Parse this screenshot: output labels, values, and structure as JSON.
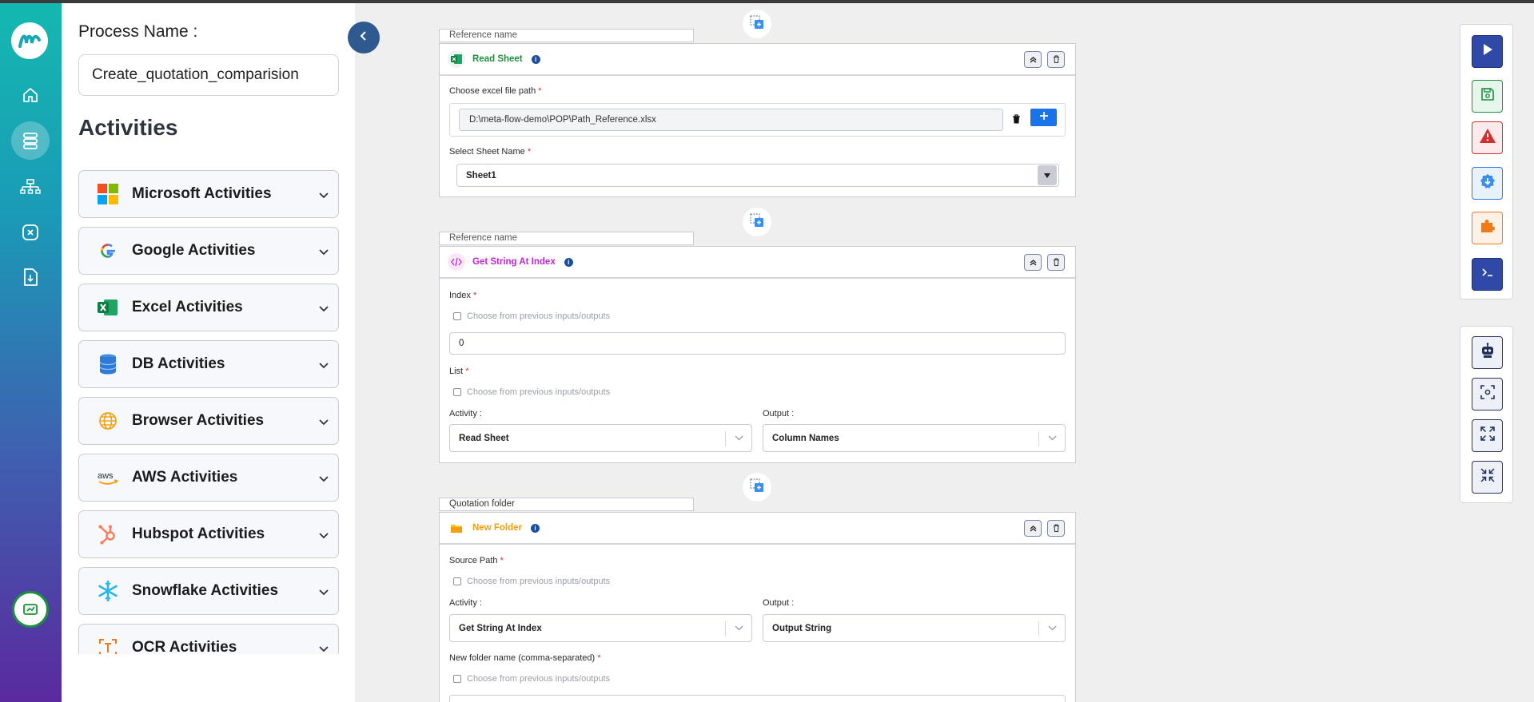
{
  "colors": {
    "accent_blue": "#1a73e8",
    "nav_dark": "#2f5a8f",
    "excel_green": "#1e8f3e",
    "string_pink": "#c026d3",
    "folder_orange": "#f59e0b",
    "danger_red": "#d32f2f"
  },
  "panel": {
    "process_label": "Process Name :",
    "process_value": "Create_quotation_comparision",
    "activities_title": "Activities",
    "categories": [
      {
        "label": "Microsoft Activities",
        "icon": "microsoft-icon"
      },
      {
        "label": "Google Activities",
        "icon": "google-icon"
      },
      {
        "label": "Excel Activities",
        "icon": "excel-icon"
      },
      {
        "label": "DB Activities",
        "icon": "database-icon"
      },
      {
        "label": "Browser Activities",
        "icon": "globe-icon"
      },
      {
        "label": "AWS Activities",
        "icon": "aws-icon"
      },
      {
        "label": "Hubspot Activities",
        "icon": "hubspot-icon"
      },
      {
        "label": "Snowflake Activities",
        "icon": "snowflake-icon"
      },
      {
        "label": "OCR Activities",
        "icon": "ocr-icon"
      }
    ]
  },
  "cards": {
    "read_sheet": {
      "ref_placeholder": "Reference name",
      "title": "Read Sheet",
      "file_label": "Choose excel file path",
      "file_value": "D:\\meta-flow-demo\\POP\\Path_Reference.xlsx",
      "sheet_label": "Select Sheet Name",
      "sheet_value": "Sheet1"
    },
    "get_string": {
      "ref_placeholder": "Reference name",
      "title": "Get String At Index",
      "index_label": "Index",
      "index_checkbox": "Choose from previous inputs/outputs",
      "index_value": "0",
      "list_label": "List",
      "list_checkbox": "Choose from previous inputs/outputs",
      "activity_label": "Activity :",
      "activity_value": "Read Sheet",
      "output_label": "Output :",
      "output_value": "Column Names"
    },
    "new_folder": {
      "ref_value": "Quotation folder",
      "title": "New Folder",
      "source_label": "Source Path",
      "source_checkbox": "Choose from previous inputs/outputs",
      "activity_label": "Activity :",
      "activity_value": "Get String At Index",
      "output_label": "Output :",
      "output_value": "Output String",
      "name_label": "New folder name (comma-separated)",
      "name_checkbox": "Choose from previous inputs/outputs"
    }
  },
  "required_mark": "*"
}
